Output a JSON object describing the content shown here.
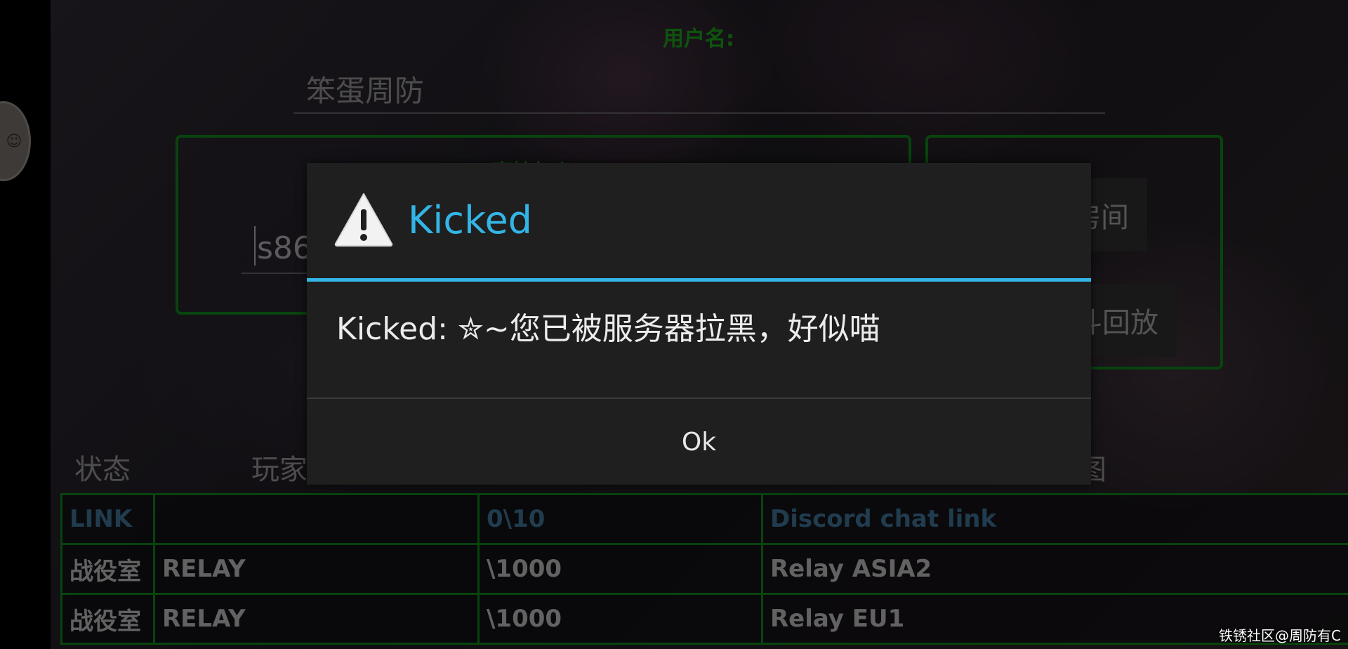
{
  "login": {
    "username_label": "用户名:",
    "username_value": "笨蛋周防",
    "panel_title": "直接加入",
    "server_input_value": "s86"
  },
  "right_panel": {
    "button_1": "房间",
    "button_2": "斗回放"
  },
  "tabs": [
    "状态",
    "玩家",
    "图"
  ],
  "table": {
    "rows": [
      [
        "LINK",
        "",
        "0\\10",
        "Discord chat link"
      ],
      [
        "战役室",
        "RELAY",
        "\\1000",
        "Relay ASIA2"
      ],
      [
        "战役室",
        "RELAY",
        "\\1000",
        "Relay EU1"
      ]
    ]
  },
  "dialog": {
    "title": "Kicked",
    "message": "Kicked: ✮~您已被服务器拉黑，好似喵",
    "ok_label": "Ok",
    "accent_color": "#33b5e5"
  },
  "watermark": "铁锈社区@周防有C",
  "colors": {
    "panel_border": "#0f7d1a",
    "label_green": "#1a9a1a",
    "link_row_text": "#3b6d8f"
  }
}
